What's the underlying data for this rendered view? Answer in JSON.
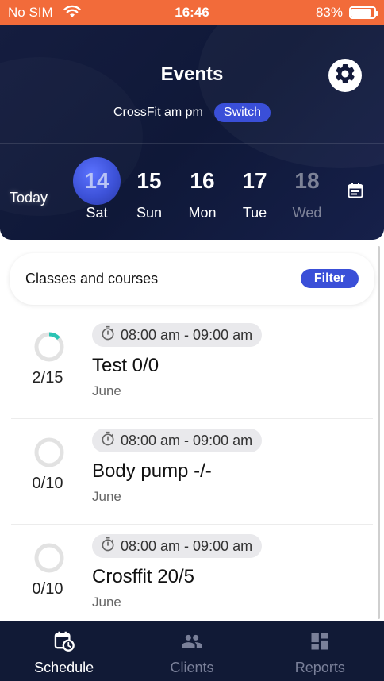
{
  "status_bar": {
    "carrier": "No SIM",
    "time": "16:46",
    "battery": "83%",
    "battery_level": 0.83
  },
  "header": {
    "title": "Events",
    "subtitle": "CrossFit am pm",
    "switch_label": "Switch",
    "settings_icon": "gear-icon"
  },
  "date_strip": {
    "today_label": "Today",
    "days": [
      {
        "num": "14",
        "weekday": "Sat",
        "selected": true
      },
      {
        "num": "15",
        "weekday": "Sun"
      },
      {
        "num": "16",
        "weekday": "Mon"
      },
      {
        "num": "17",
        "weekday": "Tue"
      },
      {
        "num": "18",
        "weekday": "Wed"
      }
    ],
    "calendar_icon": "calendar-icon"
  },
  "filter_bar": {
    "label": "Classes and courses",
    "filter_label": "Filter"
  },
  "events": [
    {
      "time": "08:00 am - 09:00 am",
      "title": "Test 0/0",
      "month": "June",
      "capacity": "2/15",
      "fill": 0.1333
    },
    {
      "time": "08:00 am - 09:00 am",
      "title": "Body pump -/-",
      "month": "June",
      "capacity": "0/10",
      "fill": 0
    },
    {
      "time": "08:00 am - 09:00 am",
      "title": "Crosffit 20/5",
      "month": "June",
      "capacity": "0/10",
      "fill": 0
    }
  ],
  "tabs": [
    {
      "label": "Schedule",
      "icon": "schedule-icon",
      "active": true
    },
    {
      "label": "Clients",
      "icon": "clients-icon"
    },
    {
      "label": "Reports",
      "icon": "reports-icon"
    }
  ],
  "colors": {
    "status_bar": "#f26b3a",
    "header_bg": "#151d3f",
    "accent": "#3a4fd8",
    "ring_fill": "#2bc4b4",
    "ring_track": "#e2e2e2",
    "tab_bar": "#111a36"
  }
}
